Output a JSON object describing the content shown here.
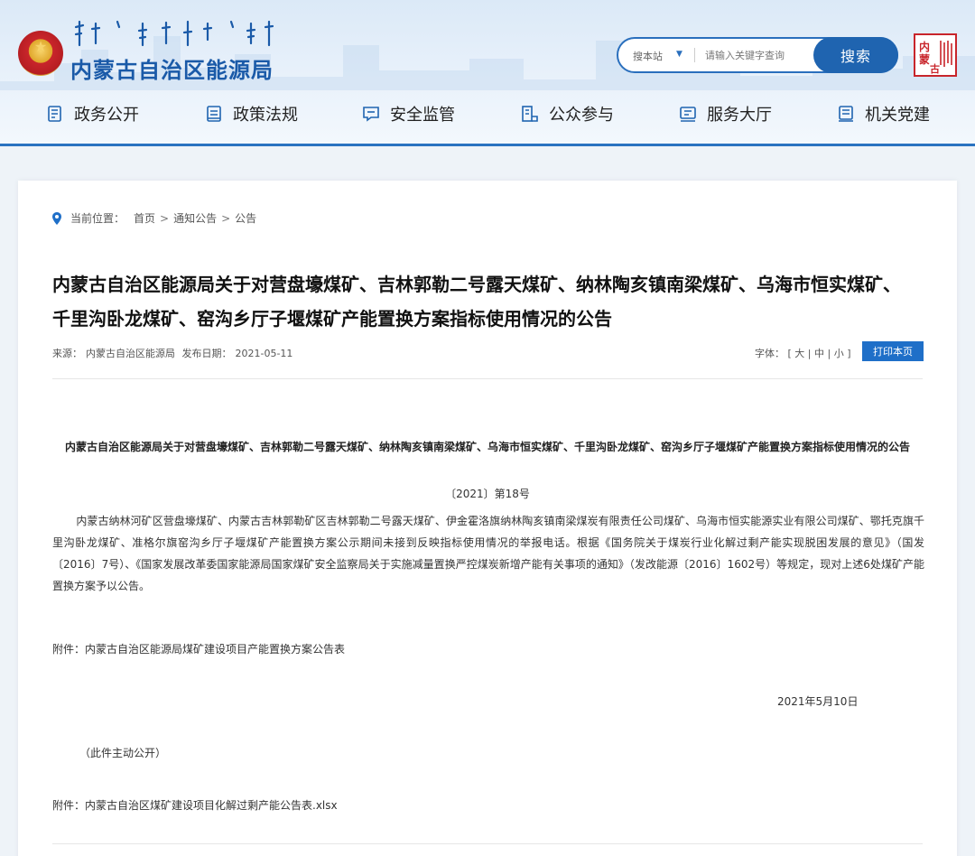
{
  "header": {
    "site_name": "内蒙古自治区能源局",
    "search": {
      "scope": "搜本站",
      "placeholder": "请输入关键字查询",
      "button": "搜索"
    },
    "seal_text": "内蒙古"
  },
  "nav": [
    {
      "label": "政务公开",
      "icon": "document-list-icon"
    },
    {
      "label": "政策法规",
      "icon": "policy-book-icon"
    },
    {
      "label": "安全监管",
      "icon": "message-board-icon"
    },
    {
      "label": "公众参与",
      "icon": "people-chart-icon"
    },
    {
      "label": "服务大厅",
      "icon": "service-hall-icon"
    },
    {
      "label": "机关党建",
      "icon": "party-building-icon"
    }
  ],
  "breadcrumb": {
    "prefix": "当前位置：",
    "items": [
      "首页",
      "通知公告",
      "公告"
    ],
    "separator": ">"
  },
  "article": {
    "title": "内蒙古自治区能源局关于对营盘壕煤矿、吉林郭勒二号露天煤矿、纳林陶亥镇南梁煤矿、乌海市恒实煤矿、千里沟卧龙煤矿、窑沟乡厅子堰煤矿产能置换方案指标使用情况的公告",
    "source_label": "来源：",
    "source": "内蒙古自治区能源局",
    "date_label": "发布日期：",
    "date": "2021-05-11",
    "font_label": "字体：",
    "font_open": "[",
    "font_large": "大",
    "font_medium": "中",
    "font_small": "小",
    "font_sep": "|",
    "font_close": "]",
    "print_button": "打印本页"
  },
  "document": {
    "title": "内蒙古自治区能源局关于对营盘壕煤矿、吉林郭勒二号露天煤矿、纳林陶亥镇南梁煤矿、乌海市恒实煤矿、千里沟卧龙煤矿、窑沟乡厅子堰煤矿产能置换方案指标使用情况的公告",
    "number": "〔2021〕第18号",
    "body": "内蒙古纳林河矿区营盘壕煤矿、内蒙古吉林郭勒矿区吉林郭勒二号露天煤矿、伊金霍洛旗纳林陶亥镇南梁煤炭有限责任公司煤矿、乌海市恒实能源实业有限公司煤矿、鄂托克旗千里沟卧龙煤矿、准格尔旗窑沟乡厅子堰煤矿产能置换方案公示期间未接到反映指标使用情况的举报电话。根据《国务院关于煤炭行业化解过剩产能实现脱困发展的意见》（国发〔2016〕7号）、《国家发展改革委国家能源局国家煤矿安全监察局关于实施减量置换严控煤炭新增产能有关事项的通知》（发改能源〔2016〕1602号）等规定，现对上述6处煤矿产能置换方案予以公告。",
    "attachment_note": "附件：内蒙古自治区能源局煤矿建设项目产能置换方案公告表",
    "sign_date": "2021年5月10日",
    "public_note": "（此件主动公开）",
    "attachment_file": "附件：内蒙古自治区煤矿建设项目化解过剩产能公告表.xlsx"
  },
  "colors": {
    "brand_blue": "#1f64b0",
    "title_blue": "#1a5aa8",
    "seal_red": "#c8252b"
  }
}
